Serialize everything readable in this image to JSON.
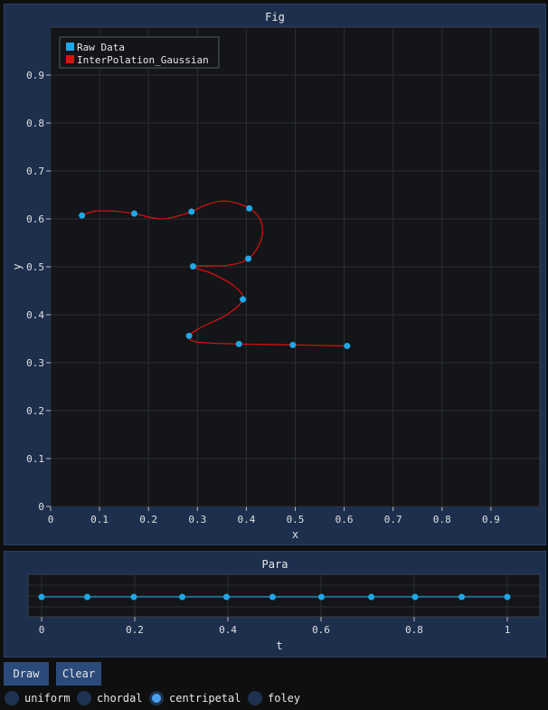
{
  "fig": {
    "title": "Fig",
    "chart_data": {
      "type": "scatter",
      "xlabel": "x",
      "ylabel": "y",
      "xlim": [
        0,
        1
      ],
      "ylim": [
        0,
        1
      ],
      "xticks": [
        "0",
        "0.1",
        "0.2",
        "0.3",
        "0.4",
        "0.5",
        "0.6",
        "0.7",
        "0.8",
        "0.9"
      ],
      "yticks": [
        "0",
        "0.1",
        "0.2",
        "0.3",
        "0.4",
        "0.5",
        "0.6",
        "0.7",
        "0.8",
        "0.9"
      ],
      "grid": true,
      "legend_position": "top-left",
      "series": [
        {
          "name": "Raw Data",
          "color": "#1fa8e8",
          "points": [
            [
              0.064,
              0.607
            ],
            [
              0.171,
              0.611
            ],
            [
              0.288,
              0.615
            ],
            [
              0.406,
              0.622
            ],
            [
              0.404,
              0.517
            ],
            [
              0.291,
              0.501
            ],
            [
              0.393,
              0.432
            ],
            [
              0.283,
              0.356
            ],
            [
              0.385,
              0.339
            ],
            [
              0.495,
              0.337
            ],
            [
              0.606,
              0.335
            ]
          ]
        },
        {
          "name": "InterPolation_Gaussian",
          "color": "#e01010",
          "points": [
            [
              0.064,
              0.607
            ],
            [
              0.09,
              0.616
            ],
            [
              0.13,
              0.616
            ],
            [
              0.171,
              0.611
            ],
            [
              0.2,
              0.604
            ],
            [
              0.23,
              0.6
            ],
            [
              0.26,
              0.606
            ],
            [
              0.288,
              0.615
            ],
            [
              0.32,
              0.63
            ],
            [
              0.36,
              0.637
            ],
            [
              0.406,
              0.622
            ],
            [
              0.43,
              0.595
            ],
            [
              0.43,
              0.555
            ],
            [
              0.404,
              0.517
            ],
            [
              0.36,
              0.503
            ],
            [
              0.291,
              0.501
            ],
            [
              0.33,
              0.486
            ],
            [
              0.375,
              0.46
            ],
            [
              0.393,
              0.432
            ],
            [
              0.36,
              0.4
            ],
            [
              0.31,
              0.375
            ],
            [
              0.283,
              0.356
            ],
            [
              0.3,
              0.343
            ],
            [
              0.385,
              0.339
            ],
            [
              0.44,
              0.338
            ],
            [
              0.495,
              0.337
            ],
            [
              0.55,
              0.336
            ],
            [
              0.606,
              0.335
            ]
          ]
        }
      ]
    }
  },
  "para": {
    "title": "Para",
    "chart_data": {
      "type": "line",
      "xlabel": "t",
      "xlim": [
        0,
        1
      ],
      "xticks": [
        "0",
        "0.2",
        "0.4",
        "0.6",
        "0.8",
        "1"
      ],
      "color": "#1fa8e8",
      "t_values": [
        0,
        0.098,
        0.198,
        0.302,
        0.397,
        0.496,
        0.601,
        0.708,
        0.802,
        0.902,
        1.0
      ]
    }
  },
  "controls": {
    "draw_label": "Draw",
    "clear_label": "Clear",
    "radios": [
      {
        "label": "uniform",
        "selected": false
      },
      {
        "label": "chordal",
        "selected": false
      },
      {
        "label": "centripetal",
        "selected": true
      },
      {
        "label": "foley",
        "selected": false
      }
    ]
  }
}
